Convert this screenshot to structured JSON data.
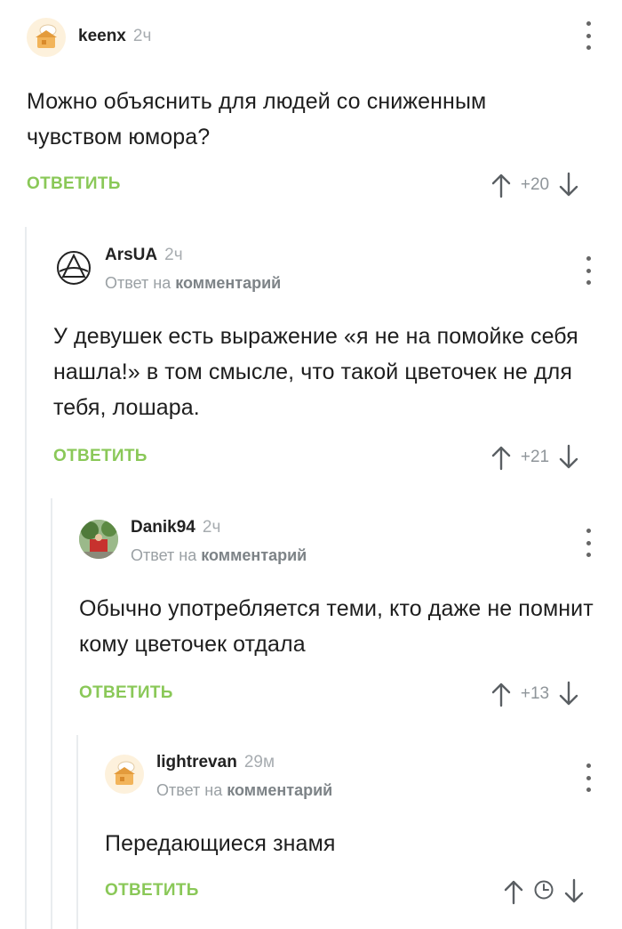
{
  "comments": [
    {
      "author": "keenx",
      "time": "2ч",
      "text": "Можно объяснить для людей со сниженным чувством юмора?",
      "reply_label": "ОТВЕТИТЬ",
      "score": "+20"
    },
    {
      "author": "ArsUA",
      "time": "2ч",
      "reply_to_prefix": "Ответ на",
      "reply_to_link": "комментарий",
      "text": "У девушек есть выражение «я не на помойке себя нашла!» в том смысле, что такой цветочек не для тебя, лошара.",
      "reply_label": "ОТВЕТИТЬ",
      "score": "+21"
    },
    {
      "author": "Danik94",
      "time": "2ч",
      "reply_to_prefix": "Ответ на",
      "reply_to_link": "комментарий",
      "text": "Обычно употребляется теми, кто даже не помнит кому цветочек отдала",
      "reply_label": "ОТВЕТИТЬ",
      "score": "+13"
    },
    {
      "author": "lightrevan",
      "time": "29м",
      "reply_to_prefix": "Ответ на",
      "reply_to_link": "комментарий",
      "text": "Передающиеся знамя",
      "reply_label": "ОТВЕТИТЬ",
      "score_icon": "clock-icon"
    }
  ],
  "colors": {
    "reply_green": "#8ac858",
    "muted_gray": "#9aa0a4",
    "thread_line": "#e9ecef"
  }
}
